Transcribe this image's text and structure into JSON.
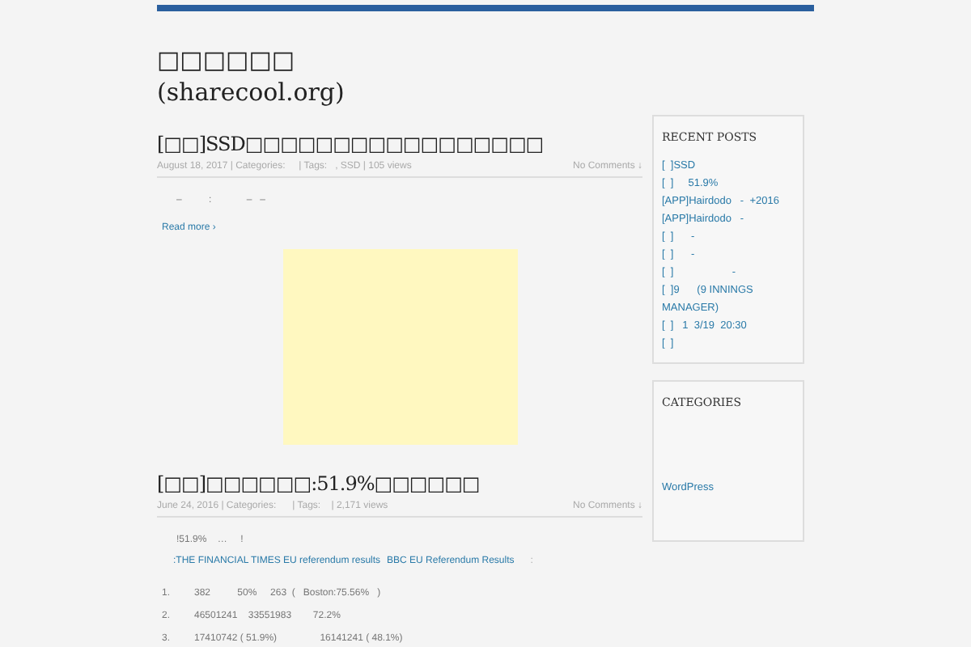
{
  "site": {
    "title": "□□□□□□",
    "subtitle": "(sharecool.org)"
  },
  "posts": [
    {
      "title": "[□□]SSD□□□□□□□□□□□□□□□□□",
      "meta": "August 18, 2017 | Categories:     | Tags:   , SSD | 105 views",
      "comments": "No Comments ↓",
      "body": [
        {
          "kind": "text",
          "text": "–          :             –   –"
        }
      ],
      "read_more": "Read more ›",
      "image": {
        "kind": "placeholder"
      }
    },
    {
      "title": "[□□]□□□□□□:51.9%□□□□□□",
      "meta": "June 24, 2016 | Categories:      | Tags:    | 2,171 views",
      "comments": "No Comments ↓",
      "body": [
        {
          "kind": "text",
          "text": "!51.9%    …     !"
        },
        {
          "kind": "links",
          "parts": [
            ":THE FINANCIAL TIMES EU referendum results",
            "BBC EU Referendum Results"
          ],
          "tail": ":"
        }
      ],
      "list": [
        {
          "number": "1.",
          "text": "382          50%     263  (   Boston:75.56%   )"
        },
        {
          "number": "2.",
          "text": "46501241    33551983        72.2%"
        },
        {
          "number": "3.",
          "text": "17410742 ( 51.9%)                16141241 ( 48.1%)"
        }
      ]
    }
  ],
  "sidebar": {
    "recent_posts": {
      "heading": "RECENT POSTS",
      "items": [
        "[  ]SSD",
        "[  ]     51.9%",
        "[APP]Hairdodo   -  +2016",
        "[APP]Hairdodo   -",
        "[  ]      -",
        "[  ]      -",
        "[  ]                    -",
        "[  ]9      (9 INNINGS MANAGER)",
        "[  ]   1  3/19  20:30",
        "[  ]"
      ]
    },
    "categories": {
      "heading": "CATEGORIES",
      "items": [
        "WordPress"
      ]
    }
  }
}
